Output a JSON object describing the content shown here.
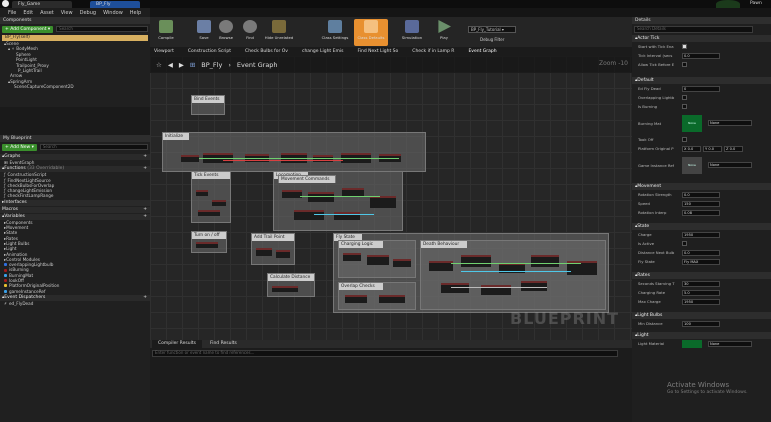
{
  "window": {
    "tabs": [
      "Fly_Game",
      "BP_Fly"
    ],
    "user": "Pawn"
  },
  "menu": [
    "File",
    "Edit",
    "Asset",
    "View",
    "Debug",
    "Window",
    "Help"
  ],
  "components": {
    "header": "Components",
    "add_label": "+ Add Component ▾",
    "search_placeholder": "Search",
    "root": "BP_Fly(self)",
    "tree": [
      "▴Scene",
      "▴ ⚬ BodyMesh",
      "Sphere",
      "PointLight",
      "Trailpoint_Proxy",
      "P_LightTrail",
      "Arrow",
      "▴SpringArm",
      "SceneCaptureComponent2D"
    ]
  },
  "myblueprint": {
    "header": "My Blueprint",
    "add_label": "+ Add New ▾",
    "search_placeholder": "Search",
    "graphs_label": "▴Graphs",
    "event_graph": "EventGraph",
    "functions_label": "▴Functions",
    "functions_count": "(33 Overridable)",
    "functions": [
      "ConstructionScript",
      "FindNextLightSource",
      "checkBulbsForOverlap",
      "changeLightEmission",
      "checkFirstLampRange"
    ],
    "interfaces_label": "▸Interfaces",
    "macros_label": "Macros",
    "variables_label": "▴Variables",
    "var_groups": [
      "▸Components",
      "▸Movement",
      "▸State",
      "▸Rates",
      "▸Light Bulbs",
      "▸Light",
      "▸Animation",
      "▸Control Modules"
    ],
    "variables": [
      {
        "name": "overlappingLightbulb",
        "color": "#2f6fe0"
      },
      {
        "name": "isBurning",
        "color": "#a01818"
      },
      {
        "name": "BurningMat",
        "color": "#3aa0e8"
      },
      {
        "name": "lookOff",
        "color": "#a01818"
      },
      {
        "name": "PlatformOriginalPosition",
        "color": "#e8c030"
      },
      {
        "name": "gameInstanceRef",
        "color": "#3aa0e8"
      }
    ],
    "dispatchers_label": "▴Event Dispatchers",
    "dispatcher": "ed_FlyDead"
  },
  "toolbar": {
    "buttons": [
      {
        "label": "Compile",
        "color": "#6a8f5a"
      },
      {
        "label": "Save",
        "color": "#6b7fa5"
      },
      {
        "label": "Browse",
        "color": "#7a7a7a"
      },
      {
        "label": "Find",
        "color": "#7a7a7a"
      },
      {
        "label": "Hide Unrelated",
        "color": "#7a6a3a"
      },
      {
        "label": "Class Settings",
        "color": "#5f7f9f"
      },
      {
        "label": "Class Defaults",
        "color": "#e89030"
      },
      {
        "label": "Simulation",
        "color": "#5a6a9a"
      },
      {
        "label": "Play",
        "color": "#6a8f6a"
      }
    ],
    "debug_select": "BP_Fly_Tutorial ▾",
    "debug_filter": "Debug Filter"
  },
  "subtabs": [
    "Viewport",
    "Construction Script",
    "Check Bulbs for Ov",
    "change Light Emis",
    "Find Next Light So",
    "Check if in Lamp R",
    "Event Graph"
  ],
  "graph": {
    "breadcrumb": "BP_Fly",
    "current": "Event Graph",
    "zoom": "Zoom -10",
    "watermark": "BLUEPRINT",
    "comments": [
      "Bind Events",
      "Initialize",
      "Tick Events",
      "Locomotion",
      "Movement Commands",
      "Turn on / off",
      "Add Trail Point",
      "Fly State",
      "Charging Logic",
      "Death Behaviour",
      "Overlap Checks",
      "Calculate Distance"
    ]
  },
  "bottom": {
    "tabs": [
      "Compiler Results",
      "Find Results"
    ],
    "search_placeholder": "Enter function or event name to find references..."
  },
  "details": {
    "header": "Details",
    "search_placeholder": "Search Details",
    "sections": {
      "actor_tick": "▴Actor Tick",
      "default": "▴Default",
      "movement": "▴Movement",
      "state": "▴State",
      "rates": "▴Rates",
      "bulbs": "▴Light Bulbs",
      "light": "▴Light"
    },
    "actor_tick": [
      {
        "k": "Start with Tick Ena",
        "cb": true
      },
      {
        "k": "Tick Interval (secs",
        "v": "0.0"
      },
      {
        "k": "Allow Tick Before E",
        "cb": false
      }
    ],
    "default": [
      {
        "k": "Ed Fly Dead",
        "v": "0"
      },
      {
        "k": "Overlapping Lightb",
        "cb": false
      },
      {
        "k": "Is Burning",
        "cb": false
      }
    ],
    "burning_mat": {
      "k": "Burning Mat",
      "thumb": "None",
      "sel": "None"
    },
    "look_off": {
      "k": "Took Off"
    },
    "platform": {
      "k": "Platform Original P",
      "x": "X  0.0",
      "y": "Y  0.0",
      "z": "Z  0.0"
    },
    "game_instance": {
      "k": "Game Instance Ref",
      "thumb": "None",
      "sel": "None"
    },
    "movement": [
      {
        "k": "Rotation Strength",
        "v": "0.0"
      },
      {
        "k": "Speed",
        "v": "150"
      },
      {
        "k": "Rotation Interp",
        "v": "0.08"
      }
    ],
    "state": [
      {
        "k": "Charge",
        "v": "1950"
      },
      {
        "k": "Is Active",
        "cb": false
      },
      {
        "k": "Distance Next Bulb",
        "v": "0.0"
      },
      {
        "k": "Fly State",
        "v": "Fly MAX"
      }
    ],
    "rates": [
      {
        "k": "Seconds Starving T",
        "v": "30"
      },
      {
        "k": "Charging Rate",
        "v": "5.0"
      },
      {
        "k": "Max Charge",
        "v": "1950"
      }
    ],
    "bulbs": [
      {
        "k": "Min Distance",
        "v": "100"
      }
    ],
    "light": {
      "k": "Light Material",
      "sel": "None"
    }
  },
  "os_watermark": {
    "line1": "Activate Windows",
    "line2": "Go to Settings to activate Windows."
  }
}
